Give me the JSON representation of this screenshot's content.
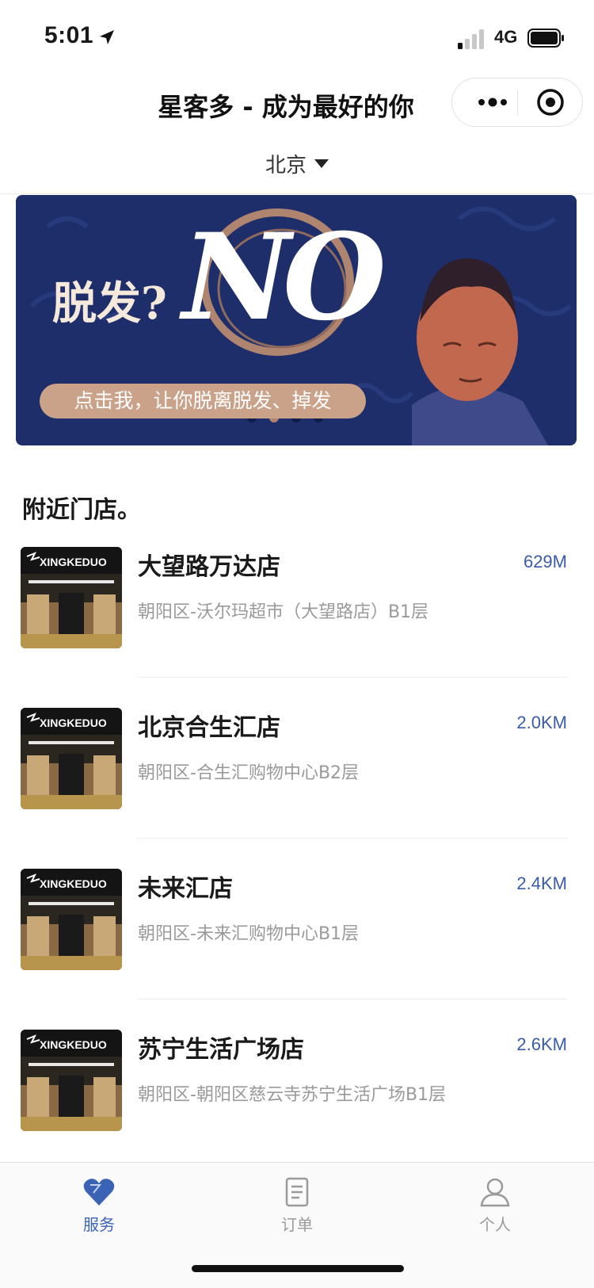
{
  "status_bar": {
    "time": "5:01",
    "network": "4G"
  },
  "nav": {
    "title": "星客多 - 成为最好的你"
  },
  "city_selector": {
    "city": "北京"
  },
  "banner": {
    "headline": "脱发?",
    "big_text": "NO",
    "cta": "点击我，让你脱离脱发、掉发",
    "dots_count": 4,
    "active_dot": 1
  },
  "section": {
    "title": "附近门店。"
  },
  "stores": [
    {
      "name": "大望路万达店",
      "address": "朝阳区-沃尔玛超市（大望路店）B1层",
      "distance": "629M",
      "thumb_brand": "XINGKEDUO"
    },
    {
      "name": "北京合生汇店",
      "address": "朝阳区-合生汇购物中心B2层",
      "distance": "2.0KM",
      "thumb_brand": "XINGKEDUO"
    },
    {
      "name": "未来汇店",
      "address": "朝阳区-未来汇购物中心B1层",
      "distance": "2.4KM",
      "thumb_brand": "XINGKEDUO"
    },
    {
      "name": "苏宁生活广场店",
      "address": "朝阳区-朝阳区慈云寺苏宁生活广场B1层",
      "distance": "2.6KM",
      "thumb_brand": "XINGKEDUO"
    }
  ],
  "tabbar": {
    "tabs": [
      {
        "label": "服务",
        "icon": "heart-icon",
        "active": true
      },
      {
        "label": "订单",
        "icon": "clipboard-icon",
        "active": false
      },
      {
        "label": "个人",
        "icon": "person-icon",
        "active": false
      }
    ]
  },
  "colors": {
    "accent": "#3a62b5",
    "distance": "#3a5ca8",
    "banner_bg": "#1d2e6b"
  }
}
